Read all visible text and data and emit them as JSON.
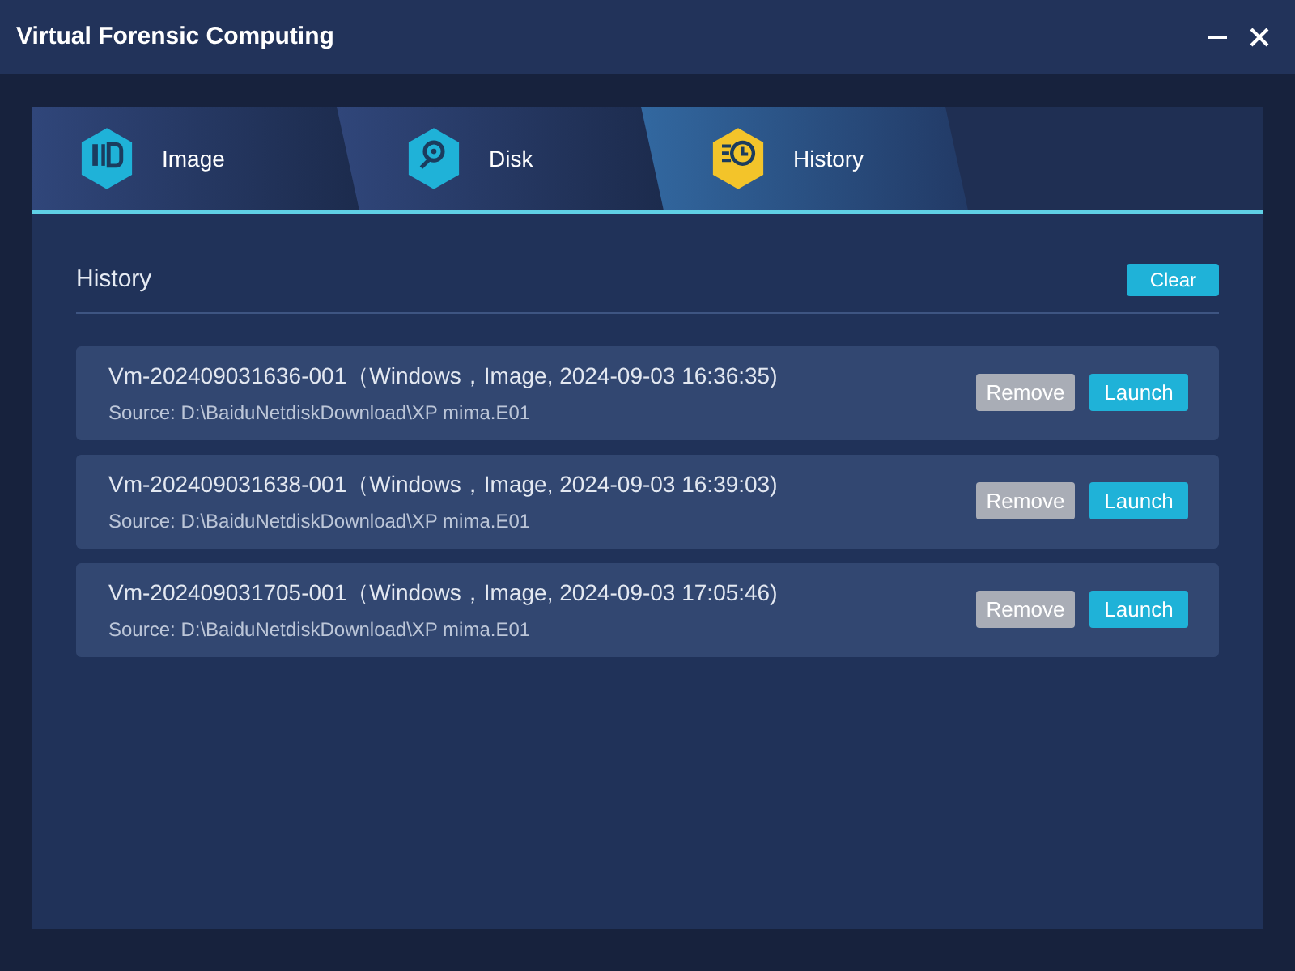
{
  "window": {
    "title": "Virtual Forensic Computing"
  },
  "tabs": [
    {
      "label": "Image",
      "kind": "image",
      "selected": false
    },
    {
      "label": "Disk",
      "kind": "disk",
      "selected": false
    },
    {
      "label": "History",
      "kind": "history",
      "selected": true
    }
  ],
  "section": {
    "title": "History",
    "clear_button": "Clear"
  },
  "history": [
    {
      "title": "Vm-202409031636-001（Windows，Image, 2024-09-03 16:36:35)",
      "source": "Source: D:\\BaiduNetdiskDownload\\XP mima.E01",
      "remove": "Remove",
      "launch": "Launch"
    },
    {
      "title": "Vm-202409031638-001（Windows，Image, 2024-09-03 16:39:03)",
      "source": "Source: D:\\BaiduNetdiskDownload\\XP mima.E01",
      "remove": "Remove",
      "launch": "Launch"
    },
    {
      "title": "Vm-202409031705-001（Windows，Image, 2024-09-03 17:05:46)",
      "source": "Source: D:\\BaiduNetdiskDownload\\XP mima.E01",
      "remove": "Remove",
      "launch": "Launch"
    }
  ]
}
